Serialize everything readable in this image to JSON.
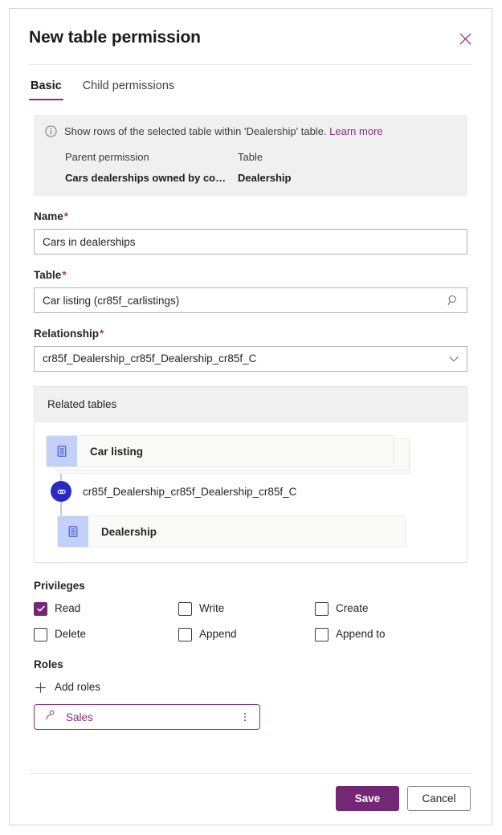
{
  "dialog": {
    "title": "New table permission",
    "close_icon": "close-icon"
  },
  "tabs": [
    {
      "label": "Basic",
      "active": true
    },
    {
      "label": "Child permissions",
      "active": false
    }
  ],
  "info_banner": {
    "icon": "info-circle-icon",
    "message": "Show rows of the selected table within 'Dealership' table.",
    "learn_more": "Learn more",
    "columns": [
      {
        "label": "Parent permission",
        "value": "Cars dealerships owned by compa..."
      },
      {
        "label": "Table",
        "value": "Dealership"
      }
    ]
  },
  "fields": {
    "name": {
      "label": "Name",
      "required_mark": "*",
      "value": "Cars in dealerships",
      "placeholder": ""
    },
    "table": {
      "label": "Table",
      "required_mark": "*",
      "value": "Car listing (cr85f_carlistings)",
      "placeholder": "",
      "icon": "search-icon"
    },
    "relationship": {
      "label": "Relationship",
      "required_mark": "*",
      "value": "cr85f_Dealership_cr85f_Dealership_cr85f_C",
      "icon": "chevron-down-icon"
    }
  },
  "related_tables": {
    "header": "Related tables",
    "nodes": [
      {
        "label": "Car listing",
        "icon": "table-icon",
        "stacked": true
      },
      {
        "label": "Dealership",
        "icon": "table-icon",
        "stacked": false
      }
    ],
    "relationship": {
      "label": "cr85f_Dealership_cr85f_Dealership_cr85f_C",
      "icon": "link-icon"
    },
    "colors": {
      "icon_tile": "#c3d0f7",
      "link_badge": "#2b2bc4",
      "card_bg": "#fafaf9",
      "header_bg": "#f0f0f0"
    }
  },
  "privileges": {
    "label": "Privileges",
    "items": [
      {
        "label": "Read",
        "checked": true
      },
      {
        "label": "Write",
        "checked": false
      },
      {
        "label": "Create",
        "checked": false
      },
      {
        "label": "Delete",
        "checked": false
      },
      {
        "label": "Append",
        "checked": false
      },
      {
        "label": "Append to",
        "checked": false
      }
    ]
  },
  "roles": {
    "label": "Roles",
    "add_label": "Add roles",
    "add_icon": "plus-icon",
    "chips": [
      {
        "name": "Sales",
        "icon": "person-icon",
        "more_icon": "more-vertical-icon"
      }
    ]
  },
  "footer": {
    "save_label": "Save",
    "cancel_label": "Cancel"
  },
  "colors": {
    "accent_purple": "#742774",
    "link_purple": "#8b2c8b",
    "required_red": "#b33a3a"
  }
}
